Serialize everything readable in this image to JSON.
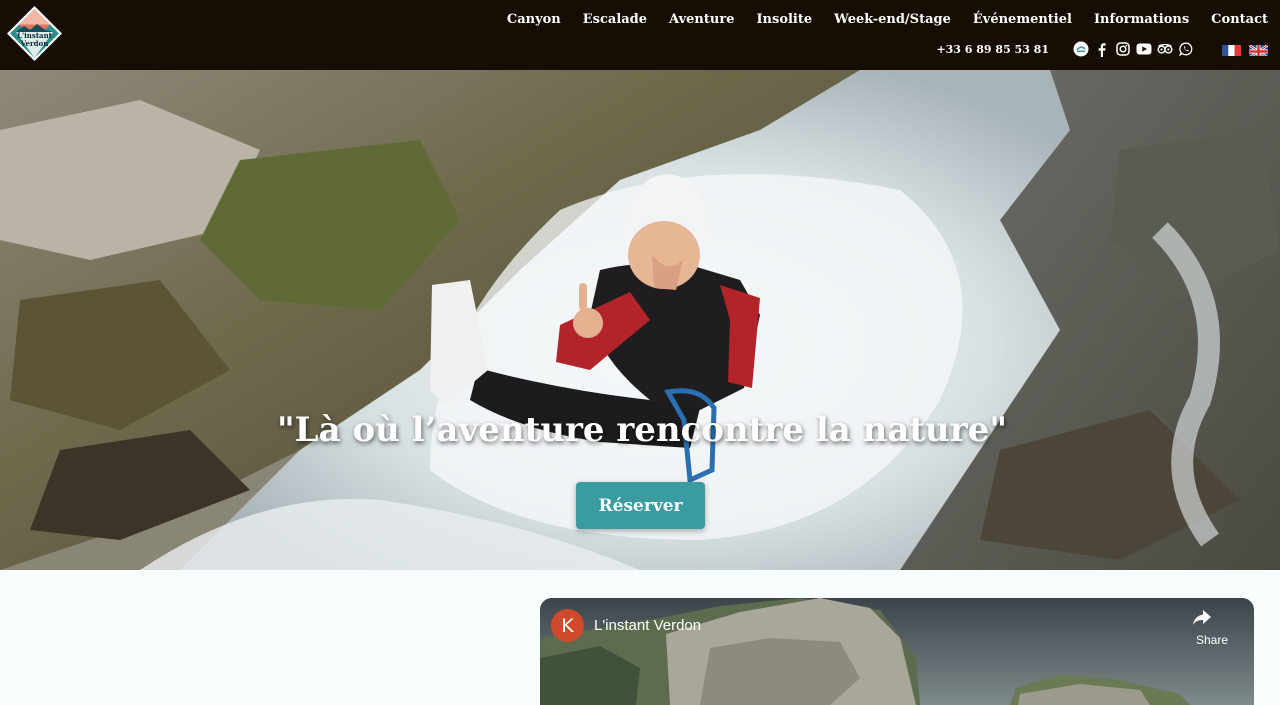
{
  "brand": {
    "logo_text_line1": "L'instant",
    "logo_text_line2": "Verdon"
  },
  "nav": {
    "items": [
      {
        "label": "Canyon"
      },
      {
        "label": "Escalade"
      },
      {
        "label": "Aventure"
      },
      {
        "label": "Insolite"
      },
      {
        "label": "Week-end/Stage"
      },
      {
        "label": "Événementiel"
      },
      {
        "label": "Informations"
      },
      {
        "label": "Contact"
      }
    ]
  },
  "contact": {
    "phone": "+33 6 89 85 53 81"
  },
  "social": {
    "icons": [
      "badge-icon",
      "facebook-icon",
      "instagram-icon",
      "youtube-icon",
      "tripadvisor-icon",
      "whatsapp-icon"
    ]
  },
  "languages": [
    {
      "code": "fr",
      "icon": "french-flag-icon"
    },
    {
      "code": "en",
      "icon": "uk-flag-icon"
    }
  ],
  "hero": {
    "quote": "\"Là où l’aventure rencontre la nature\"",
    "button_label": "Réserver"
  },
  "video": {
    "channel_initial": "K",
    "title": "L'instant Verdon",
    "share_label": "Share"
  },
  "colors": {
    "header_bg": "#160d05",
    "accent": "#3a9ba0",
    "page_bg": "#f7fcfd"
  }
}
